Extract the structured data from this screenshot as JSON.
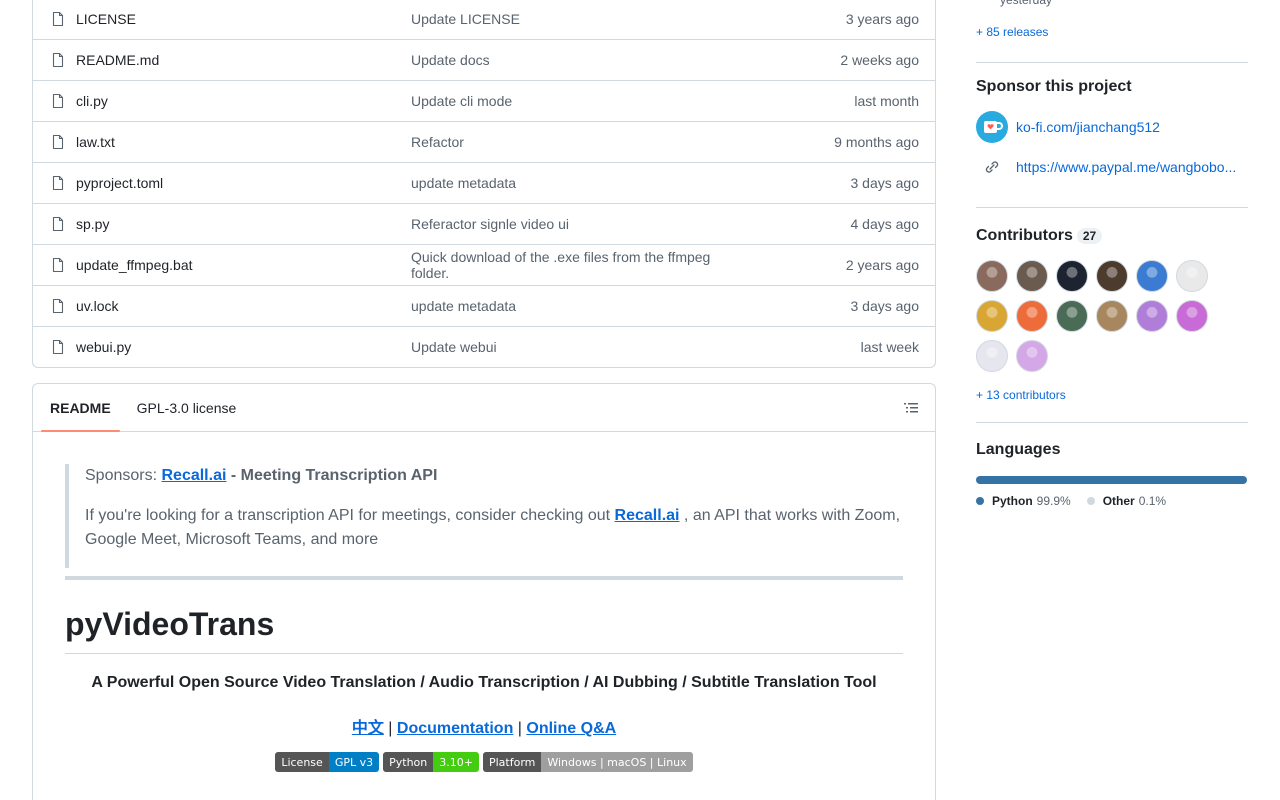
{
  "files": [
    {
      "name": "LICENSE",
      "message": "Update LICENSE",
      "age": "3 years ago"
    },
    {
      "name": "README.md",
      "message": "Update docs",
      "age": "2 weeks ago"
    },
    {
      "name": "cli.py",
      "message": "Update cli mode",
      "age": "last month"
    },
    {
      "name": "law.txt",
      "message": "Refactor",
      "age": "9 months ago"
    },
    {
      "name": "pyproject.toml",
      "message": "update metadata",
      "age": "3 days ago"
    },
    {
      "name": "sp.py",
      "message": "Referactor signle video ui",
      "age": "4 days ago"
    },
    {
      "name": "update_ffmpeg.bat",
      "message": "Quick download of the .exe files from the ffmpeg folder.",
      "age": "2 years ago"
    },
    {
      "name": "uv.lock",
      "message": "update metadata",
      "age": "3 days ago"
    },
    {
      "name": "webui.py",
      "message": "Update webui",
      "age": "last week"
    }
  ],
  "readme": {
    "tabs": [
      "README",
      "GPL-3.0 license"
    ],
    "sponsor_prefix": "Sponsors: ",
    "sponsor_link": "Recall.ai",
    "sponsor_suffix": " - Meeting Transcription API",
    "para_prefix": "If you're looking for a transcription API for meetings, consider checking out ",
    "para_link": "Recall.ai",
    "para_suffix": " , an API that works with Zoom, Google Meet, Microsoft Teams, and more",
    "title": "pyVideoTrans",
    "subtitle": "A Powerful Open Source Video Translation / Audio Transcription / AI Dubbing / Subtitle Translation Tool",
    "links": {
      "zh": "中文",
      "sep": " | ",
      "docs": "Documentation",
      "qa": "Online Q&A"
    },
    "badges": [
      {
        "label": "License",
        "value": "GPL v3",
        "color": "#007ec6"
      },
      {
        "label": "Python",
        "value": "3.10+",
        "color": "#4c1"
      },
      {
        "label": "Platform",
        "value": "Windows | macOS | Linux",
        "color": "#9f9f9f"
      }
    ]
  },
  "sidebar": {
    "yesterday": "yesterday",
    "releases_link": "+ 85 releases",
    "sponsor_title": "Sponsor this project",
    "sponsor_links": [
      "ko-fi.com/jianchang512",
      "https://www.paypal.me/wangbobo..."
    ],
    "contributors_title": "Contributors",
    "contributors_count": "27",
    "contributors_link": "+ 13 contributors",
    "languages_title": "Languages",
    "languages": [
      {
        "name": "Python",
        "pct": "99.9%",
        "value": 99.9,
        "color": "#3572A5"
      },
      {
        "name": "Other",
        "pct": "0.1%",
        "value": 0.1,
        "color": "#ededed"
      }
    ],
    "avatar_colors": [
      "#8a6a5c",
      "#6b5b4e",
      "#1d2330",
      "#4d3b2e",
      "#3b7bd1",
      "#e9e9e9",
      "#d9a634",
      "#ee6b3a",
      "#4a6b55",
      "#a8865e",
      "#b07ed8",
      "#c86bd6",
      "#e6e6ef",
      "#d4a8e6"
    ]
  }
}
